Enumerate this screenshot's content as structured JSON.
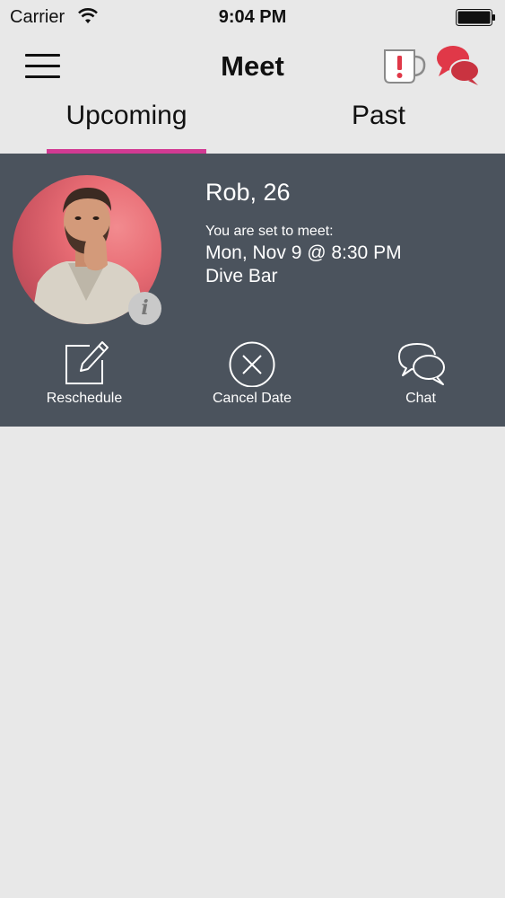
{
  "status_bar": {
    "carrier": "Carrier",
    "time": "9:04 PM"
  },
  "nav": {
    "title": "Meet",
    "menu_icon": "hamburger-menu-icon",
    "mug_icon": "alert-mug-icon",
    "chat_icon": "chat-bubbles-icon"
  },
  "tabs": [
    {
      "label": "Upcoming",
      "selected": true
    },
    {
      "label": "Past",
      "selected": false
    }
  ],
  "meeting": {
    "name_age": "Rob, 26",
    "set_label": "You are set to meet:",
    "datetime": "Mon, Nov 9 @ 8:30 PM",
    "place": "Dive Bar",
    "info_glyph": "i"
  },
  "actions": [
    {
      "label": "Reschedule",
      "icon": "edit-square-icon"
    },
    {
      "label": "Cancel Date",
      "icon": "cancel-circle-icon"
    },
    {
      "label": "Chat",
      "icon": "chat-outline-icon"
    }
  ],
  "colors": {
    "accent": "#d23a93",
    "card_bg": "#4b535d",
    "background": "#e8e8e8",
    "icon_red": "#e03848"
  }
}
